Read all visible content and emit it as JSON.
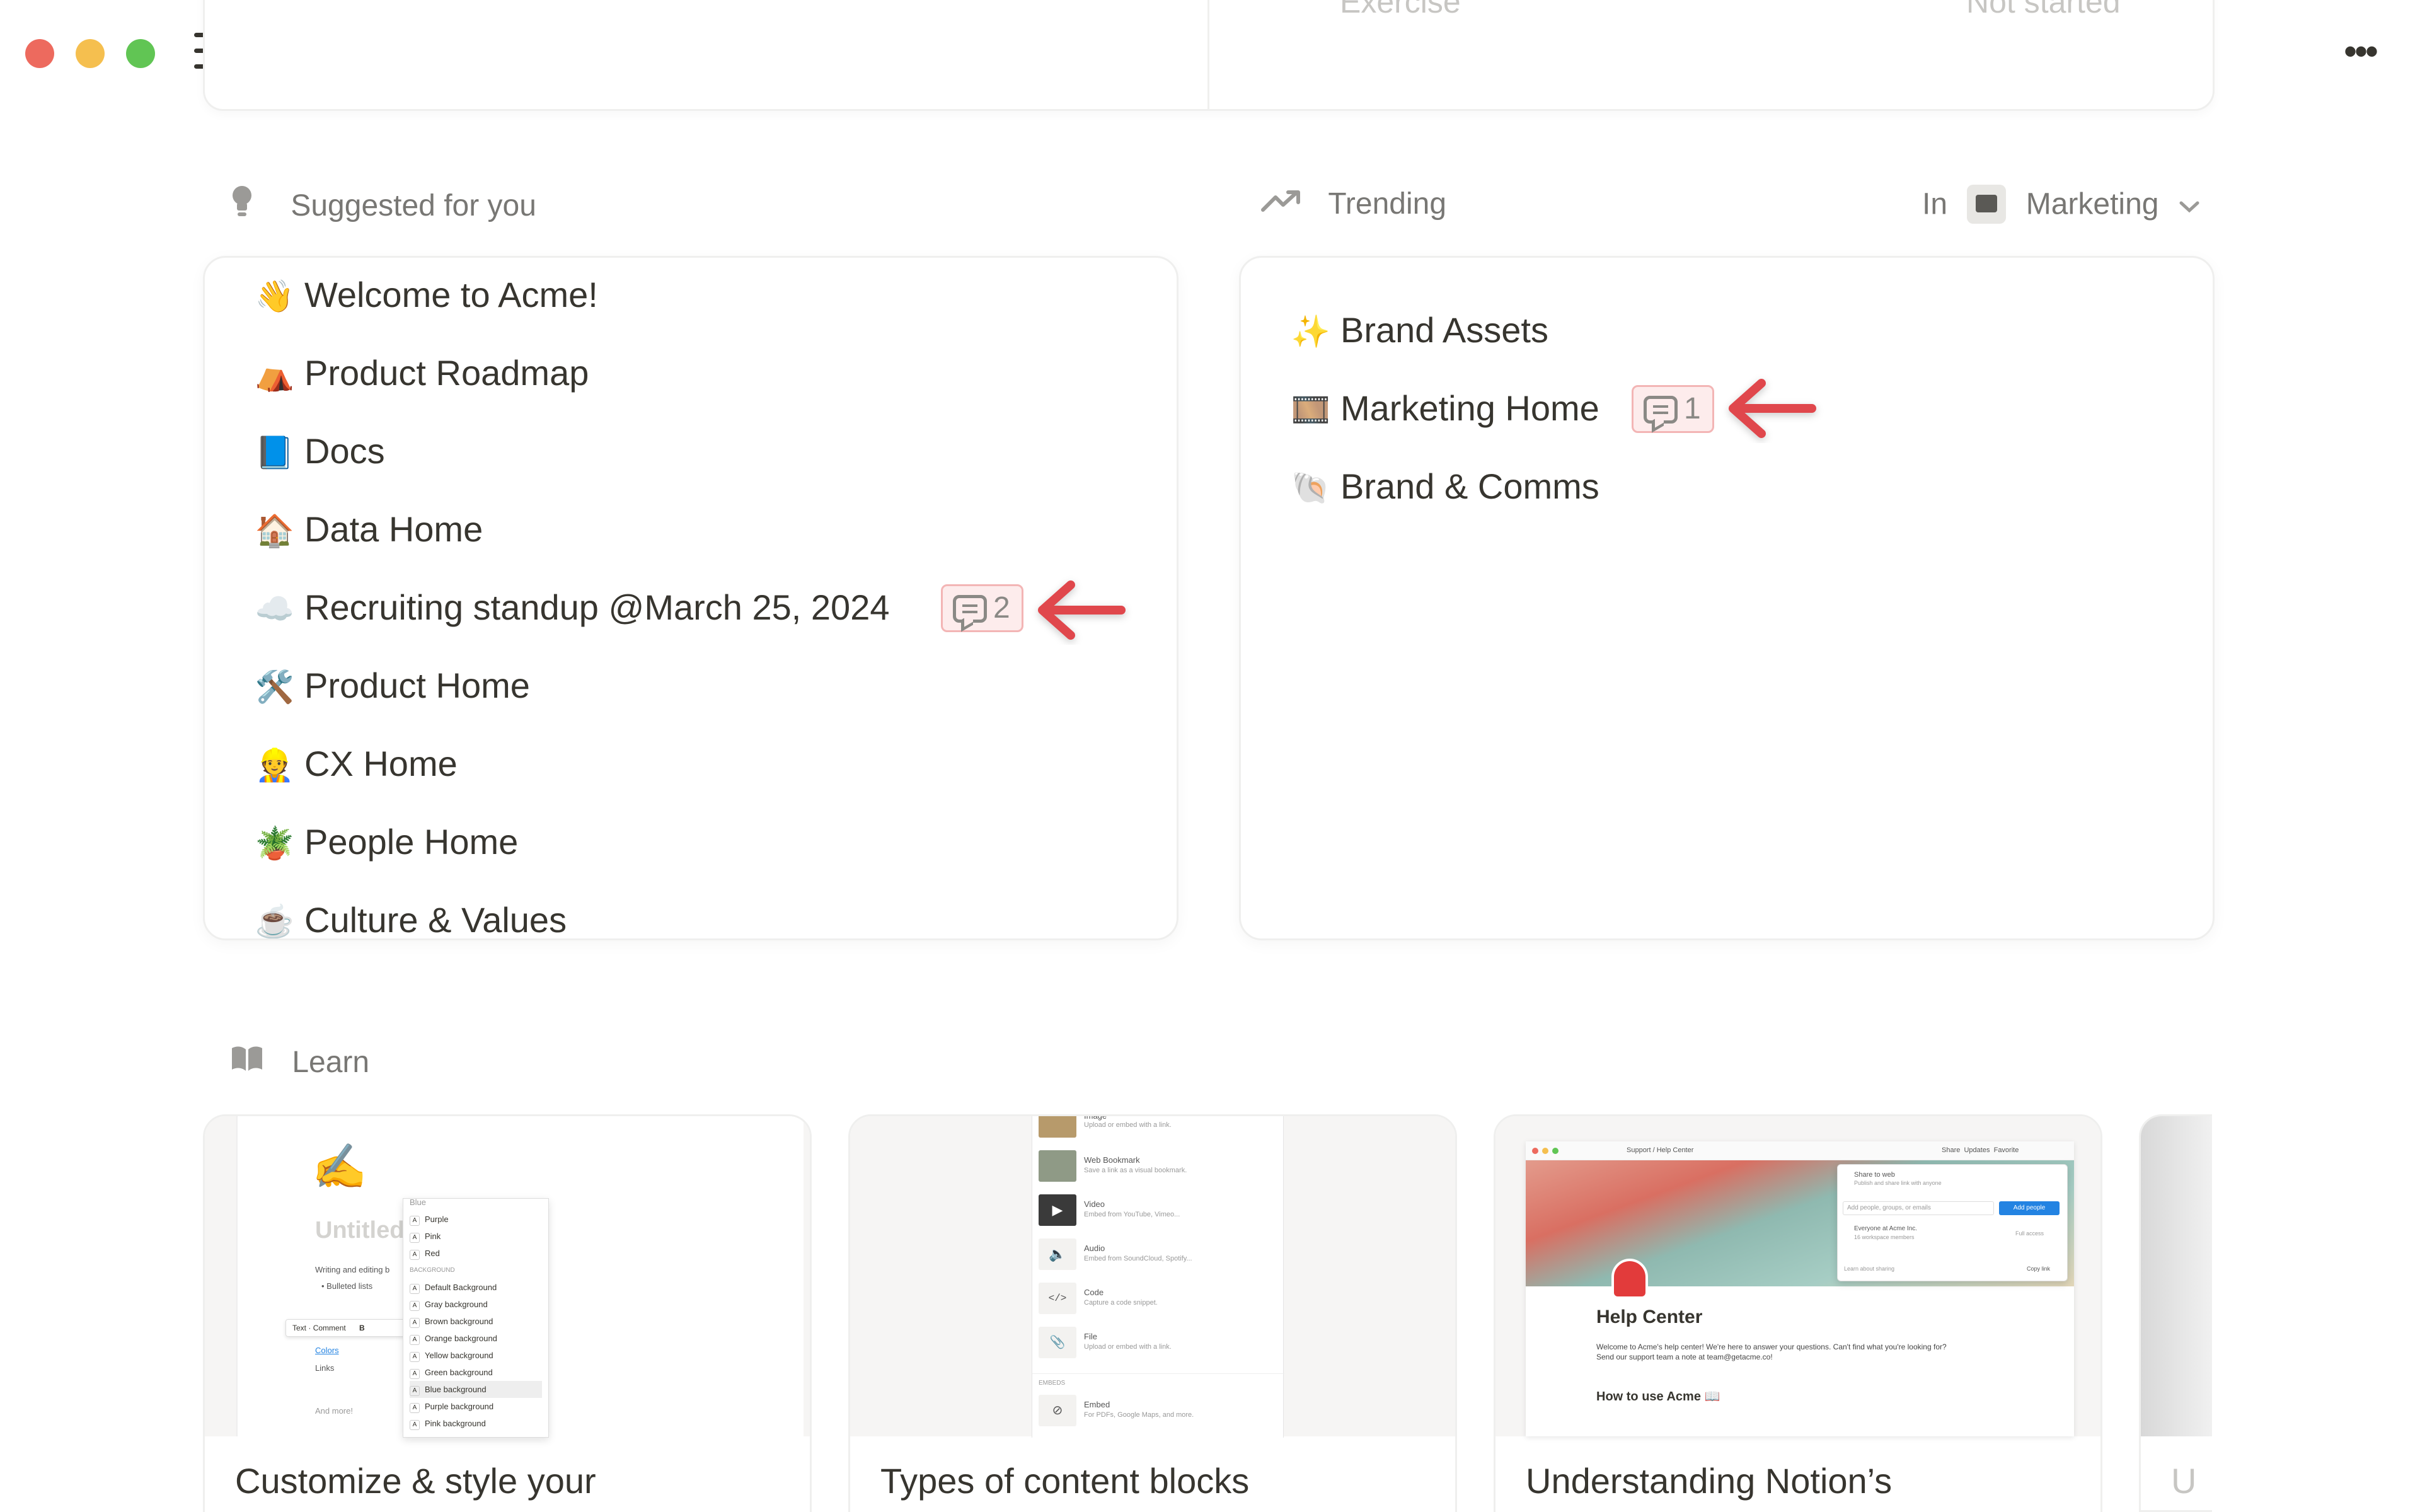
{
  "window": {
    "colors": {
      "close": "#ed6a5e",
      "minimize": "#f5bf4f",
      "zoom": "#61c554"
    },
    "nav": {
      "back_icon": "arrow-left-icon",
      "forward_icon": "arrow-right-icon",
      "new_icon": "plus-icon"
    },
    "more_label": "•••"
  },
  "top_card": {
    "ghost_left": "Exercise",
    "ghost_right": "Not started"
  },
  "suggested": {
    "header": "Suggested for you",
    "items": [
      {
        "emoji": "👋",
        "label": "Welcome to Acme!"
      },
      {
        "emoji": "⛺",
        "label": "Product Roadmap"
      },
      {
        "emoji": "📘",
        "label": "Docs"
      },
      {
        "emoji": "🏠",
        "label": "Data Home"
      },
      {
        "emoji": "☁️",
        "label": "Recruiting standup @March 25, 2024",
        "comments": "2"
      },
      {
        "emoji": "🛠️",
        "label": "Product Home"
      },
      {
        "emoji": "👷",
        "label": "CX Home"
      },
      {
        "emoji": "🪴",
        "label": "People Home"
      },
      {
        "emoji": "☕",
        "label": "Culture & Values"
      }
    ]
  },
  "trending": {
    "header": "Trending",
    "filter_prefix": "In",
    "filter_value": "Marketing",
    "items": [
      {
        "emoji": "✨",
        "label": "Brand Assets"
      },
      {
        "emoji": "🎞️",
        "label": "Marketing Home",
        "comments": "1"
      },
      {
        "emoji": "🐚",
        "label": "Brand & Comms"
      }
    ]
  },
  "learn": {
    "header": "Learn",
    "cards": [
      {
        "title": "Customize & style your",
        "thumb": {
          "heading": "Untitled",
          "text1": "Writing and editing b",
          "bullet": "Bulleted lists",
          "colors": "Colors",
          "links": "Links",
          "more": "And more!",
          "toolbar_text": "Text",
          "toolbar_comment": "Comment",
          "toolbar_bold": "B",
          "section": "BACKGROUND",
          "menu_top": [
            "Blue",
            "Purple",
            "Pink",
            "Red"
          ],
          "menu_bg": [
            "Default Background",
            "Gray background",
            "Brown background",
            "Orange background",
            "Yellow background",
            "Green background",
            "Blue background",
            "Purple background",
            "Pink background"
          ]
        }
      },
      {
        "title": "Types of content blocks",
        "thumb": {
          "section": "EMBEDS",
          "blocks": [
            {
              "name": "Image",
              "desc": "Upload or embed with a link."
            },
            {
              "name": "Web Bookmark",
              "desc": "Save a link as a visual bookmark."
            },
            {
              "name": "Video",
              "desc": "Embed from YouTube, Vimeo..."
            },
            {
              "name": "Audio",
              "desc": "Embed from SoundCloud, Spotify..."
            },
            {
              "name": "Code",
              "desc": "Capture a code snippet."
            },
            {
              "name": "File",
              "desc": "Upload or embed with a link."
            },
            {
              "name": "Embed",
              "desc": "For PDFs, Google Maps, and more."
            }
          ]
        }
      },
      {
        "title": "Understanding Notion’s",
        "thumb": {
          "crumb1": "Support",
          "crumb2": "Help Center",
          "share": "Share",
          "updates": "Updates",
          "favorite": "Favorite",
          "share_web": "Share to web",
          "share_web_desc": "Publish and share link with anyone",
          "add_placeholder": "Add people, groups, or emails",
          "add_btn": "Add people",
          "everyone": "Everyone at Acme Inc.",
          "everyone_desc": "16 workspace members",
          "full_access": "Full access",
          "learn_sharing": "Learn about sharing",
          "copy_link": "Copy link",
          "help_title": "Help Center",
          "help_body": "Welcome to Acme's help center! We're here to answer your questions. Can't find what you're looking for? Send our support team a note at team@getacme.co!",
          "howto": "How to use Acme 📖"
        }
      },
      {
        "title": "U"
      }
    ]
  }
}
